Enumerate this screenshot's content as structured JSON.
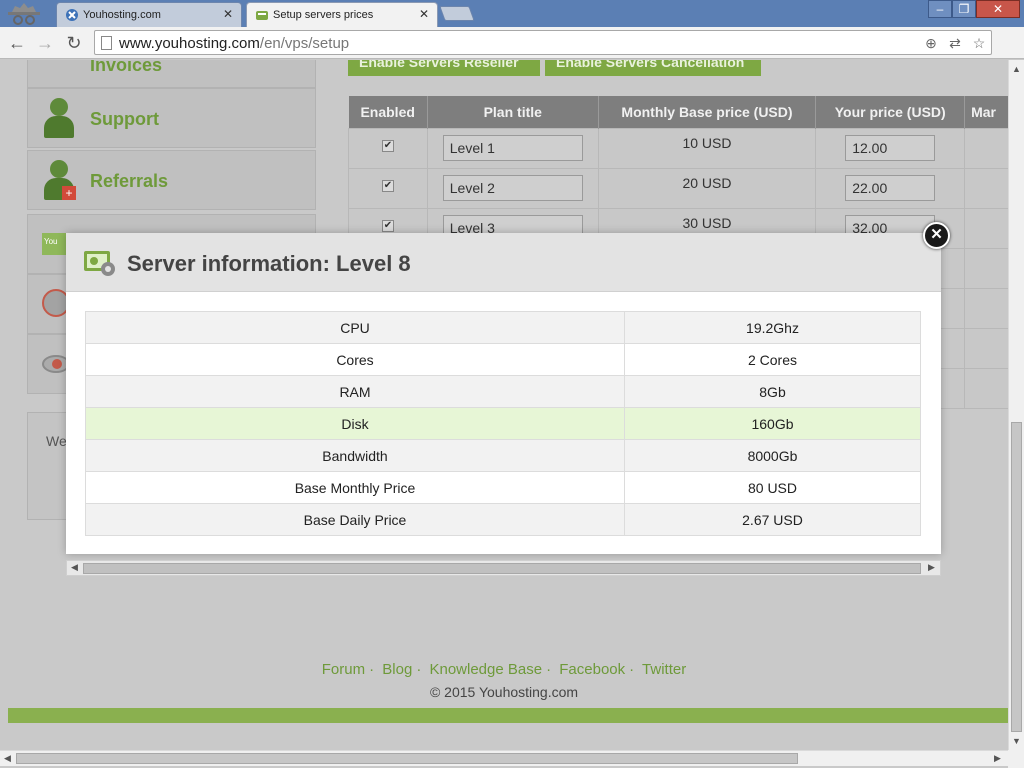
{
  "browser": {
    "tabs": [
      {
        "label": "Youhosting.com",
        "active": false
      },
      {
        "label": "Setup servers prices",
        "active": true
      }
    ],
    "url_host": "www.youhosting.com",
    "url_path": "/en/vps/setup"
  },
  "sidebar": {
    "items": [
      {
        "label": "Invoices"
      },
      {
        "label": "Support"
      },
      {
        "label": "Referrals"
      }
    ],
    "welcome_text": "We"
  },
  "actions": {
    "enable_reseller": "Enable Servers Reseller",
    "enable_cancellation": "Enable Servers Cancellation"
  },
  "plans_table": {
    "headers": [
      "Enabled",
      "Plan title",
      "Monthly Base price (USD)",
      "Your price (USD)",
      "Mar"
    ],
    "rows": [
      {
        "title": "Level 1",
        "base": "10 USD",
        "price": "12.00"
      },
      {
        "title": "Level 2",
        "base": "20 USD",
        "price": "22.00"
      },
      {
        "title": "Level 3",
        "base": "30 USD",
        "price": "32.00"
      }
    ]
  },
  "modal": {
    "title": "Server information: Level 8",
    "rows": [
      {
        "key": "CPU",
        "value": "19.2Ghz"
      },
      {
        "key": "Cores",
        "value": "2 Cores"
      },
      {
        "key": "RAM",
        "value": "8Gb"
      },
      {
        "key": "Disk",
        "value": "160Gb"
      },
      {
        "key": "Bandwidth",
        "value": "8000Gb"
      },
      {
        "key": "Base Monthly Price",
        "value": "80 USD"
      },
      {
        "key": "Base Daily Price",
        "value": "2.67 USD"
      }
    ]
  },
  "footer": {
    "links": [
      "Forum",
      "Blog",
      "Knowledge Base",
      "Facebook",
      "Twitter"
    ],
    "copyright": "© 2015 Youhosting.com"
  }
}
